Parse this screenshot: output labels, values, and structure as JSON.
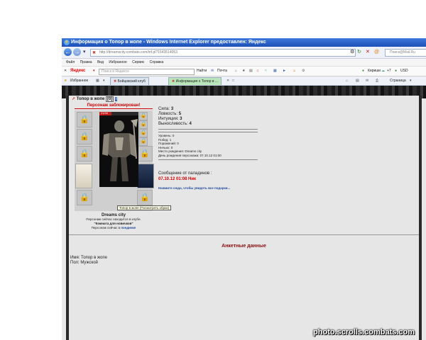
{
  "window": {
    "title": "Информация о Топор в жопе - Windows Internet Explorer предоставлен: Яндекс"
  },
  "address_bar": {
    "url": "http://dreamscity.combats.com/inf.pl?1543514053",
    "search_placeholder": "Поиск@Mail.Ru"
  },
  "menu": [
    "Файл",
    "Правка",
    "Вид",
    "Избранное",
    "Сервис",
    "Справка"
  ],
  "yandex_bar": {
    "logo": "Яндекс",
    "search_placeholder": "Поиск в Яндексе",
    "find_label": "Найти",
    "mail_label": "Почта",
    "weather_city": "Кириши",
    "temperature": "+7",
    "currency": "USD"
  },
  "favorites_bar": {
    "favorites_label": "Избранное",
    "tabs": [
      "Бойцовский клуб",
      "Информация о Топор в ..."
    ],
    "page_menu": "Страница"
  },
  "character": {
    "name": "Топор в жопе",
    "level": "[0]",
    "blocked_text": "Персонаж заблокирован!",
    "hp_text": "21/30",
    "tooltip": "Топор в жопе (Посмотреть образ)",
    "city": "Dreams city",
    "location_line1": "Персонаж сейчас находится в клубе.",
    "location_room": "\"Комната для новичков\"",
    "location_line3_prefix": "Персонаж сейчас в",
    "location_line3_link": "поединке"
  },
  "stats": [
    {
      "label": "Сила:",
      "value": "3"
    },
    {
      "label": "Ловкость:",
      "value": "5"
    },
    {
      "label": "Интуиция:",
      "value": "3"
    },
    {
      "label": "Выносливость:",
      "value": "4"
    }
  ],
  "info": [
    "Уровень: 0",
    "Побед: 1",
    "Поражений: 0",
    "Ничьих: 0",
    "Место рождения: Dreams city",
    "День рождения персонажа: 07.10.12 01:00"
  ],
  "paladin": {
    "header": "Сообщение от паладинов :",
    "date_nick": "07.10.12 01:08 Ник"
  },
  "gifts_link": "Нажмите сюда, чтобы увидеть все подарки...",
  "anketa": {
    "title": "Анкетные данные",
    "name_line": "Имя: Топор в жопе",
    "sex_line": "Пол: Мужской"
  },
  "watermark": "photo.scrolls.combats.com"
}
